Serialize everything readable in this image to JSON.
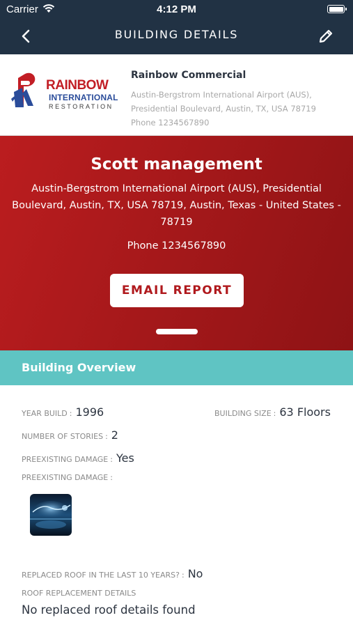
{
  "status_bar": {
    "carrier": "Carrier",
    "time": "4:12 PM"
  },
  "nav": {
    "title": "BUILDING DETAILS",
    "back_icon": "chevron-left-icon",
    "edit_icon": "pencil-icon"
  },
  "company": {
    "logo": {
      "line1": "RAINBOW",
      "line2": "INTERNATIONAL",
      "line3": "RESTORATION"
    },
    "name": "Rainbow Commercial",
    "address_line1": "Austin-Bergstrom International Airport (AUS),",
    "address_line2": "Presidential Boulevard, Austin, TX, USA 78719",
    "phone": "Phone 1234567890"
  },
  "client": {
    "name": "Scott management",
    "address_line1": "Austin-Bergstrom International Airport (AUS), Presidential",
    "address_line2": "Boulevard, Austin, TX, USA 78719, Austin, Texas - United States -",
    "address_line3": "78719",
    "phone": "Phone 1234567890",
    "email_button": "EMAIL REPORT"
  },
  "overview": {
    "title": "Building Overview",
    "year_build_label": "YEAR BUILD",
    "year_build_value": "1996",
    "building_size_label": "BUILDING SIZE",
    "building_size_value": "63 Floors",
    "stories_label": "NUMBER OF STORIES",
    "stories_value": "2",
    "damage_label": "PREEXISTING DAMAGE",
    "damage_value": "Yes",
    "damage_photos_label": "PREEXISTING DAMAGE",
    "replaced_roof_label": "REPLACED ROOF IN THE LAST 10 YEARS?",
    "replaced_roof_value": "No",
    "roof_details_label": "ROOF REPLACEMENT DETAILS",
    "roof_details_value": "No replaced roof details found"
  },
  "colors": {
    "header": "#213244",
    "banner": "#a4181a",
    "accent_teal": "#5fc4c3",
    "text_dark": "#2c3440",
    "label_gray": "#8a8a8a"
  }
}
